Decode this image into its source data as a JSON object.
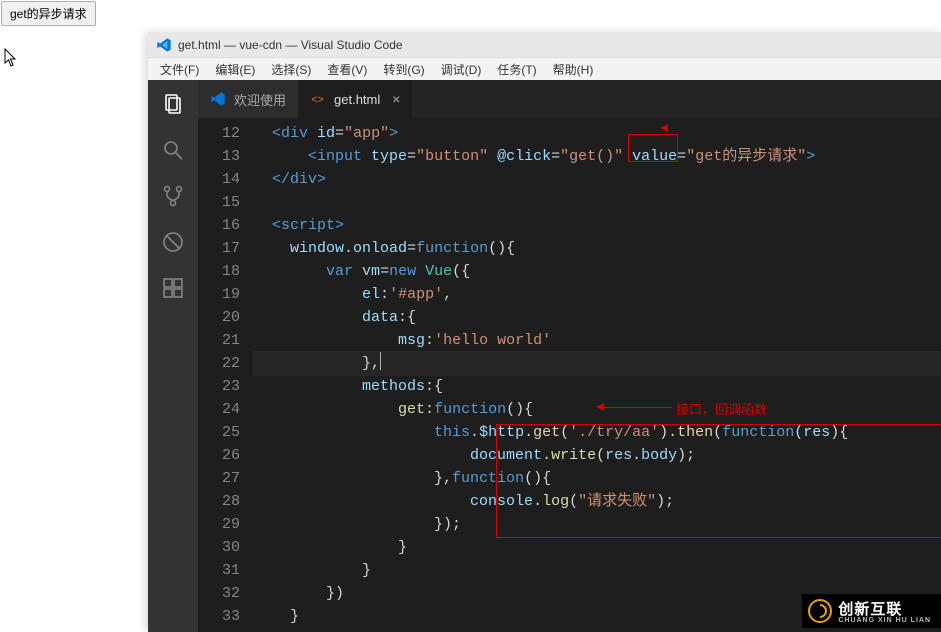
{
  "page": {
    "button_label": "get的异步请求"
  },
  "window": {
    "title": "get.html — vue-cdn — Visual Studio Code",
    "menu": [
      "文件(F)",
      "编辑(E)",
      "选择(S)",
      "查看(V)",
      "转到(G)",
      "调试(D)",
      "任务(T)",
      "帮助(H)"
    ]
  },
  "activity_icons": [
    "files-icon",
    "search-icon",
    "git-icon",
    "debug-icon",
    "extensions-icon"
  ],
  "tabs": [
    {
      "icon": "vs-icon",
      "label": "欢迎使用",
      "active": false,
      "closable": false
    },
    {
      "icon": "code-icon",
      "label": "get.html",
      "active": true,
      "closable": true
    }
  ],
  "editor": {
    "first_line_number": 12,
    "cursor_line_number": 22,
    "lines": [
      [
        {
          "t": "text",
          "v": "  "
        },
        {
          "t": "tag",
          "v": "<div "
        },
        {
          "t": "attr",
          "v": "id"
        },
        {
          "t": "text",
          "v": "="
        },
        {
          "t": "str",
          "v": "\"app\""
        },
        {
          "t": "tag",
          "v": ">"
        }
      ],
      [
        {
          "t": "text",
          "v": "      "
        },
        {
          "t": "tag",
          "v": "<input "
        },
        {
          "t": "attr",
          "v": "type"
        },
        {
          "t": "text",
          "v": "="
        },
        {
          "t": "str",
          "v": "\"button\""
        },
        {
          "t": "text",
          "v": " "
        },
        {
          "t": "attr",
          "v": "@click"
        },
        {
          "t": "text",
          "v": "="
        },
        {
          "t": "str",
          "v": "\"get()\""
        },
        {
          "t": "text",
          "v": " "
        },
        {
          "t": "attr",
          "v": "value"
        },
        {
          "t": "text",
          "v": "="
        },
        {
          "t": "str",
          "v": "\"get的异步请求\""
        },
        {
          "t": "tag",
          "v": ">"
        }
      ],
      [
        {
          "t": "text",
          "v": "  "
        },
        {
          "t": "tag",
          "v": "</div>"
        }
      ],
      [],
      [
        {
          "t": "text",
          "v": "  "
        },
        {
          "t": "tag",
          "v": "<script>"
        }
      ],
      [
        {
          "t": "text",
          "v": "    "
        },
        {
          "t": "ident",
          "v": "window"
        },
        {
          "t": "text",
          "v": "."
        },
        {
          "t": "ident",
          "v": "onload"
        },
        {
          "t": "text",
          "v": "="
        },
        {
          "t": "kw",
          "v": "function"
        },
        {
          "t": "text",
          "v": "(){"
        }
      ],
      [
        {
          "t": "text",
          "v": "        "
        },
        {
          "t": "kw",
          "v": "var"
        },
        {
          "t": "text",
          "v": " "
        },
        {
          "t": "ident",
          "v": "vm"
        },
        {
          "t": "text",
          "v": "="
        },
        {
          "t": "kw",
          "v": "new"
        },
        {
          "t": "text",
          "v": " "
        },
        {
          "t": "type",
          "v": "Vue"
        },
        {
          "t": "text",
          "v": "({"
        }
      ],
      [
        {
          "t": "text",
          "v": "            "
        },
        {
          "t": "ident",
          "v": "el"
        },
        {
          "t": "text",
          "v": ":"
        },
        {
          "t": "str",
          "v": "'#app'"
        },
        {
          "t": "text",
          "v": ","
        }
      ],
      [
        {
          "t": "text",
          "v": "            "
        },
        {
          "t": "ident",
          "v": "data"
        },
        {
          "t": "text",
          "v": ":{"
        }
      ],
      [
        {
          "t": "text",
          "v": "                "
        },
        {
          "t": "ident",
          "v": "msg"
        },
        {
          "t": "text",
          "v": ":"
        },
        {
          "t": "str",
          "v": "'hello world'"
        }
      ],
      [
        {
          "t": "text",
          "v": "            },"
        }
      ],
      [
        {
          "t": "text",
          "v": "            "
        },
        {
          "t": "ident",
          "v": "methods"
        },
        {
          "t": "text",
          "v": ":{"
        }
      ],
      [
        {
          "t": "text",
          "v": "                "
        },
        {
          "t": "fn",
          "v": "get"
        },
        {
          "t": "text",
          "v": ":"
        },
        {
          "t": "kw",
          "v": "function"
        },
        {
          "t": "text",
          "v": "(){"
        }
      ],
      [
        {
          "t": "text",
          "v": "                    "
        },
        {
          "t": "kw",
          "v": "this"
        },
        {
          "t": "text",
          "v": "."
        },
        {
          "t": "ident",
          "v": "$http"
        },
        {
          "t": "text",
          "v": "."
        },
        {
          "t": "fn",
          "v": "get"
        },
        {
          "t": "text",
          "v": "("
        },
        {
          "t": "str",
          "v": "'./try/aa'"
        },
        {
          "t": "text",
          "v": ")."
        },
        {
          "t": "fn",
          "v": "then"
        },
        {
          "t": "text",
          "v": "("
        },
        {
          "t": "kw",
          "v": "function"
        },
        {
          "t": "text",
          "v": "("
        },
        {
          "t": "ident",
          "v": "res"
        },
        {
          "t": "text",
          "v": "){"
        }
      ],
      [
        {
          "t": "text",
          "v": "                        "
        },
        {
          "t": "ident",
          "v": "document"
        },
        {
          "t": "text",
          "v": "."
        },
        {
          "t": "fn",
          "v": "write"
        },
        {
          "t": "text",
          "v": "("
        },
        {
          "t": "ident",
          "v": "res"
        },
        {
          "t": "text",
          "v": "."
        },
        {
          "t": "ident",
          "v": "body"
        },
        {
          "t": "text",
          "v": ");"
        }
      ],
      [
        {
          "t": "text",
          "v": "                    },"
        },
        {
          "t": "kw",
          "v": "function"
        },
        {
          "t": "text",
          "v": "(){"
        }
      ],
      [
        {
          "t": "text",
          "v": "                        "
        },
        {
          "t": "ident",
          "v": "console"
        },
        {
          "t": "text",
          "v": "."
        },
        {
          "t": "fn",
          "v": "log"
        },
        {
          "t": "text",
          "v": "("
        },
        {
          "t": "str",
          "v": "\"请求失败\""
        },
        {
          "t": "text",
          "v": ");"
        }
      ],
      [
        {
          "t": "text",
          "v": "                    });"
        }
      ],
      [
        {
          "t": "text",
          "v": "                }"
        }
      ],
      [
        {
          "t": "text",
          "v": "            }"
        }
      ],
      [
        {
          "t": "text",
          "v": "        })"
        }
      ],
      [
        {
          "t": "text",
          "v": "    }"
        }
      ]
    ]
  },
  "annotations": {
    "callout_text": "接口，回调函数"
  },
  "watermark": {
    "line1": "创新互联",
    "line2": "CHUANG XIN HU LIAN"
  }
}
